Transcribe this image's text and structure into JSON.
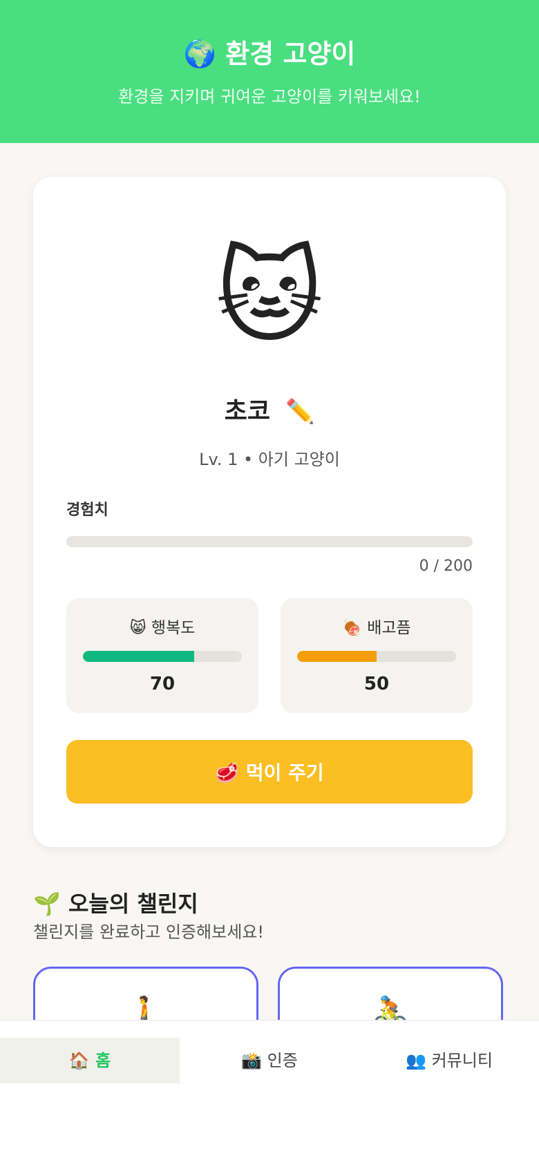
{
  "header": {
    "icon": "🌍",
    "title": "환경 고양이",
    "subtitle": "환경을 지키며 귀여운 고양이를 키워보세요!"
  },
  "cat": {
    "avatar": "🐱",
    "name": "초코",
    "edit_icon": "✏️",
    "level_text": "Lv. 1 • 아기 고양이",
    "exp_label": "경험치",
    "exp_text": "0 / 200",
    "exp_progress": 0
  },
  "stats": {
    "happiness": {
      "icon": "😸",
      "label": "행복도",
      "value": "70",
      "fill": 0.7,
      "color": "#10b981"
    },
    "hunger": {
      "icon": "🍖",
      "label": "배고픔",
      "value": "50",
      "fill": 0.5,
      "color": "#f59e0b"
    }
  },
  "feed_button": {
    "icon": "🥩",
    "label": "먹이 주기",
    "color": "#fbbf24"
  },
  "challenges": {
    "icon": "🌱",
    "title": "오늘의 챌린지",
    "subtitle": "챌린지를 완료하고 인증해보세요!",
    "cards": [
      {
        "icon": "🚶"
      },
      {
        "icon": "🚴"
      }
    ]
  },
  "nav": {
    "items": [
      {
        "icon": "🏠",
        "label": "홈",
        "active": true
      },
      {
        "icon": "📸",
        "label": "인증",
        "active": false
      },
      {
        "icon": "👥",
        "label": "커뮤니티",
        "active": false
      }
    ]
  },
  "colors": {
    "header_bg": "#4ade80",
    "page_bg": "#f8f7f4",
    "card_border": "#6366f1",
    "nav_active": "#22c55e"
  }
}
